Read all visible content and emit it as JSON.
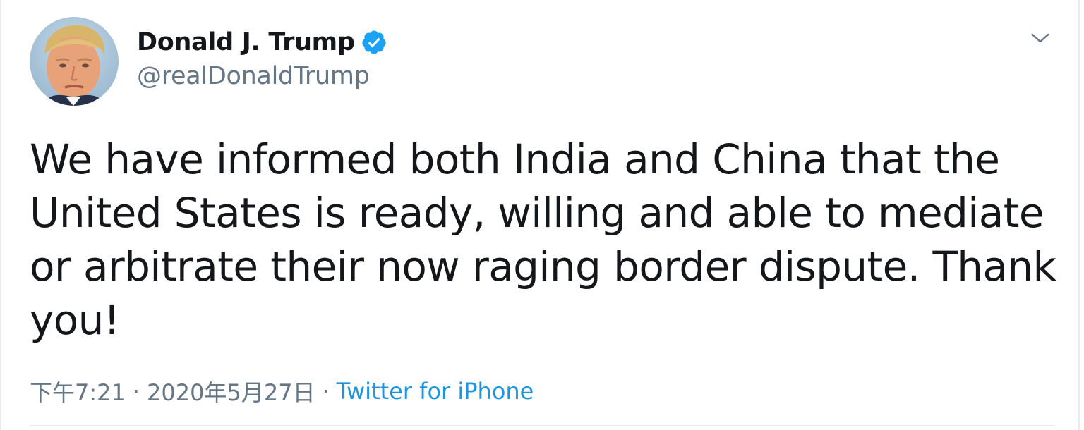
{
  "tweet": {
    "author": {
      "display_name": "Donald J. Trump",
      "handle": "@realDonaldTrump",
      "verified": true,
      "avatar_icon": "profile-photo"
    },
    "text": "We have informed both India and China that the United States is ready, willing and able to mediate or arbitrate their now raging border dispute. Thank you!",
    "time": "下午7:21",
    "separator": "·",
    "date": "2020年5月27日",
    "source": "Twitter for iPhone",
    "menu_icon": "chevron-down-icon"
  },
  "colors": {
    "text_primary": "#14171a",
    "text_secondary": "#657786",
    "link": "#1b95e0",
    "verified_badge": "#1da1f2",
    "divider": "#e6ecf0"
  }
}
